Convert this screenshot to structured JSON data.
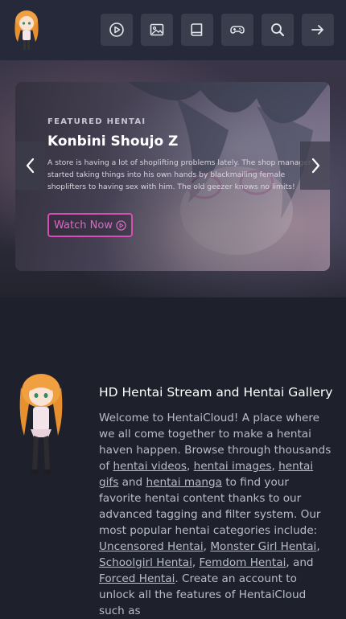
{
  "nav": {
    "items": [
      {
        "name": "play-icon"
      },
      {
        "name": "image-icon"
      },
      {
        "name": "book-icon"
      },
      {
        "name": "gamepad-icon"
      },
      {
        "name": "search-icon"
      },
      {
        "name": "arrow-right-icon"
      }
    ]
  },
  "featured": {
    "label": "FEATURED HENTAI",
    "title": "Konbini Shoujo Z",
    "description": "A store is having a lot of shoplifting problems lately. The shop manager started taking things into his own hands by blackmailing female shoplifters to having sex with him. The old geezer knows no limits!",
    "watch_label": "Watch Now"
  },
  "about": {
    "title": "HD Hentai Stream and Hentai Gallery",
    "t1": "Welcome to HentaiCloud! A place where we all come together to make a hentai haven happen. Browse through thousands of ",
    "l1": "hentai videos",
    "t2": ", ",
    "l2": "hentai images",
    "t3": ", ",
    "l3": "hentai gifs",
    "t4": " and ",
    "l4": "hentai manga",
    "t5": " to find your favorite hentai content thanks to our advanced tagging and filter system. Our most popular hentai categories include: ",
    "l5": "Uncensored Hentai",
    "t6": ", ",
    "l6": "Monster Girl Hentai",
    "t7": ", ",
    "l7": "Schoolgirl Hentai",
    "t8": ", ",
    "l8": "Femdom Hentai",
    "t9": ", and ",
    "l9": "Forced Hentai",
    "t10": ". Create an account to unlock all the features of HentaiCloud such as"
  },
  "colors": {
    "accent": "#d44fb6",
    "background": "#1e202b",
    "topbar": "#262939",
    "button": "#3a3d4c"
  }
}
